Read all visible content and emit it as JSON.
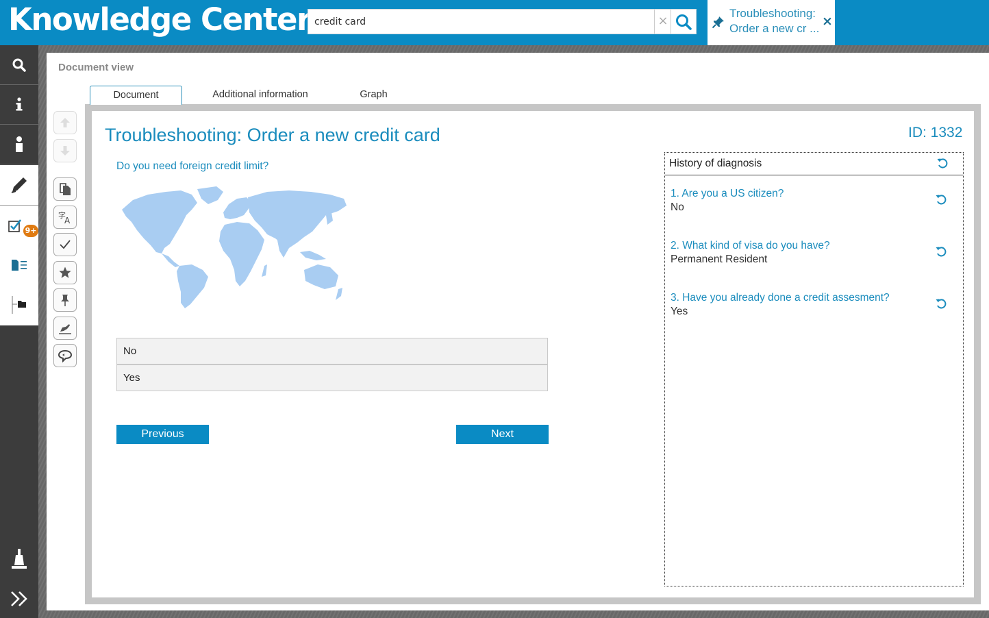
{
  "header": {
    "app_title": "Knowledge Center",
    "search": {
      "value": "credit card",
      "clear_symbol": "×"
    },
    "pinned_tab": {
      "title": "Troubleshooting: Order a new cr ...",
      "close_symbol": "×"
    }
  },
  "rail": {
    "items": [
      {
        "name": "search",
        "icon": "search-icon"
      },
      {
        "name": "info",
        "icon": "info-icon"
      },
      {
        "name": "user",
        "icon": "user-icon"
      },
      {
        "name": "edit",
        "icon": "pencil-icon"
      },
      {
        "name": "tasks",
        "icon": "checklist-icon",
        "badge": "9+"
      },
      {
        "name": "documents",
        "icon": "document-list-icon"
      },
      {
        "name": "folders",
        "icon": "folder-tree-icon"
      },
      {
        "name": "alerts",
        "icon": "beacon-icon"
      },
      {
        "name": "expand",
        "icon": "double-chevron-right-icon"
      }
    ]
  },
  "view": {
    "label": "Document view",
    "tabs": [
      {
        "label": "Document",
        "active": true
      },
      {
        "label": "Additional information",
        "active": false
      },
      {
        "label": "Graph",
        "active": false
      }
    ]
  },
  "document": {
    "title": "Troubleshooting: Order a new credit card",
    "id": "ID: 1332",
    "question": "Do you need foreign credit limit?",
    "answers": [
      "No",
      "Yes"
    ],
    "previous_label": "Previous",
    "next_label": "Next"
  },
  "history": {
    "title": "History of diagnosis",
    "items": [
      {
        "question": "1. Are you a US citizen?",
        "answer": "No"
      },
      {
        "question": "2. What kind of visa do you have?",
        "answer": "Permanent Resident"
      },
      {
        "question": "3. Have you already done a credit assesment?",
        "answer": "Yes"
      }
    ]
  },
  "colors": {
    "accent": "#0a8bc4",
    "title_blue": "#1a8cbd",
    "badge": "#e07b12",
    "rail": "#3c3c3c",
    "map": "#a9cdf2"
  }
}
